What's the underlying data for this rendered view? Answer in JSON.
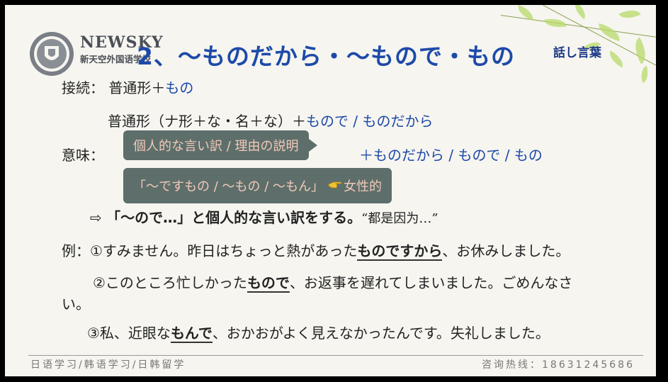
{
  "logo": {
    "brand_en": "NEWSKY",
    "brand_cn": "新天空外国语学校"
  },
  "header": {
    "title": "2、～ものだから・～もので・もの",
    "series": "話し言葉"
  },
  "connection": {
    "label": "接続：",
    "line1_prefix": "普通形＋",
    "line1_value": "もの",
    "line2_prefix": "普通形（ナ形＋な・名＋な）＋",
    "line2_value": "もので / ものだから"
  },
  "meaning": {
    "label": "意味：",
    "callout1": "個人的な言い訳 / 理由の説明",
    "forms": "＋ものだから / もので / もの",
    "callout2_text": "「～ですもの / ～もの / ～もん」",
    "callout2_icon": "pointing-hand-icon",
    "callout2_tag": "女性的",
    "note_arrow": "⇨",
    "note_bold": "「～ので…」と個人的な言い訳をする。",
    "note_cn": "“都是因为…”"
  },
  "examples": {
    "label": "例：",
    "ex1": {
      "pre": "①すみません。昨日はちょっと熱があった",
      "key": "ものですから",
      "post": "、お休みしました。"
    },
    "ex2": {
      "pre": "②このところ忙しかった",
      "key": "もので",
      "post": "、お返事を遅れてしまいました。ごめんなさ",
      "wrap": "い。"
    },
    "ex3": {
      "pre": "③私、近眼な",
      "key": "もんで",
      "post": "、おかおがよく見えなかったんです。失礼しました。"
    }
  },
  "footer": {
    "left": "日语学习/韩语学习/日韩留学",
    "right": "咨询热线：18631245686"
  },
  "colors": {
    "title": "#1d4aa8",
    "callout_bg": "#5e6f6b",
    "callout_text": "#f2c9b9"
  }
}
